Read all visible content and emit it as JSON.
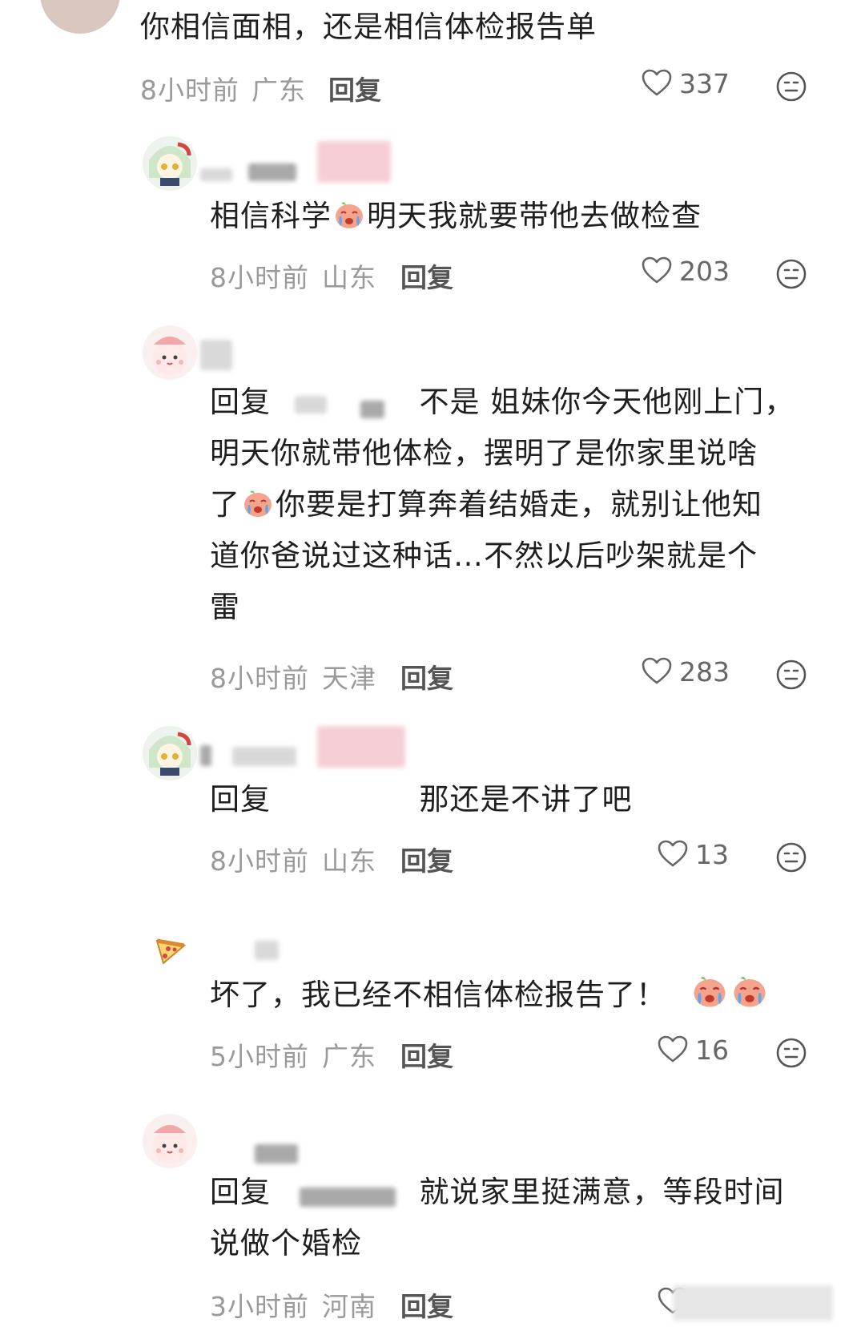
{
  "top_comment": {
    "text": "你相信面相，还是相信体检报告单",
    "time": "8小时前",
    "location": "广东",
    "reply_label": "回复",
    "likes": "337"
  },
  "replies": [
    {
      "text_a": "相信科学",
      "text_b": "明天我就要带他去做检查",
      "time": "8小时前",
      "location": "山东",
      "reply_label": "回复",
      "likes": "203"
    },
    {
      "prefix": "回复",
      "line1": "不是 姐妹你今天他刚上门，",
      "line2": "明天你就带他体检，摆明了是你家里说啥",
      "line3a": "了",
      "line3b": "你要是打算奔着结婚走，就别让他知",
      "line4": "道你爸说过这种话…不然以后吵架就是个",
      "line5": "雷",
      "time": "8小时前",
      "location": "天津",
      "reply_label": "回复",
      "likes": "283"
    },
    {
      "prefix": "回复",
      "text": "那还是不讲了吧",
      "time": "8小时前",
      "location": "山东",
      "reply_label": "回复",
      "likes": "13"
    },
    {
      "text": "坏了，我已经不相信体检报告了！",
      "time": "5小时前",
      "location": "广东",
      "reply_label": "回复",
      "likes": "16"
    },
    {
      "prefix": "回复",
      "line1": "就说家里挺满意，等段时间",
      "line2": "说做个婚检",
      "time": "3小时前",
      "location": "河南",
      "reply_label": "回复"
    }
  ],
  "icons": {
    "like": "heart-outline-icon",
    "dislike": "face-icon",
    "emoji_cry": "crying-face-emoji"
  },
  "colors": {
    "text": "#1f1f1f",
    "meta": "#9a9a9a",
    "reply": "#555555"
  }
}
